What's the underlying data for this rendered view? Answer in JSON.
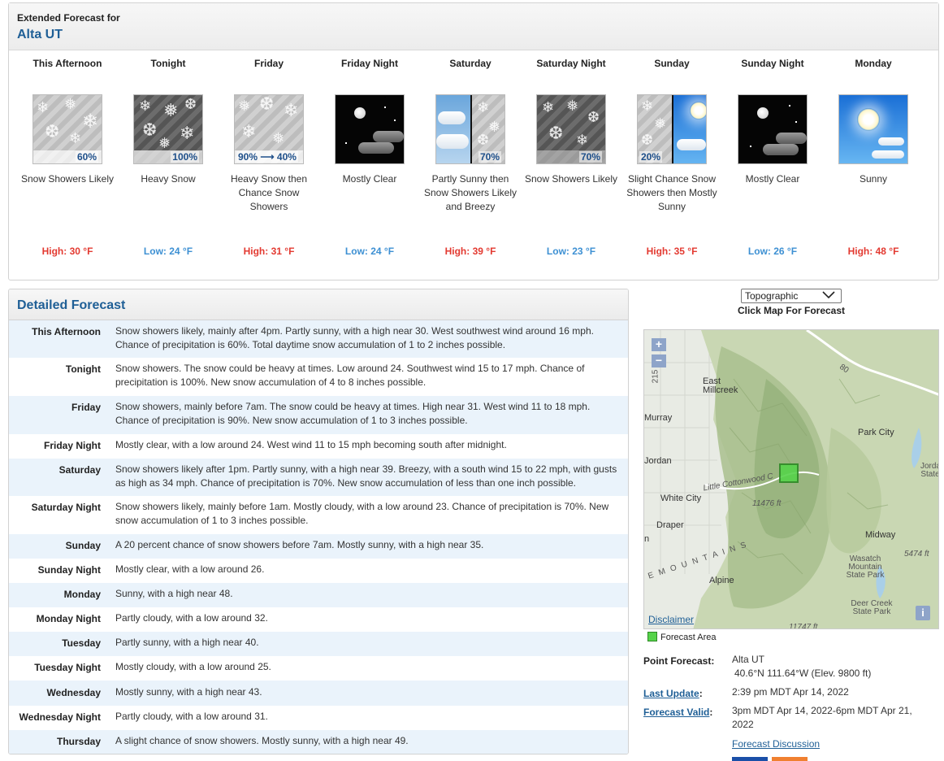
{
  "extended": {
    "heading_small": "Extended Forecast for",
    "location": "Alta UT",
    "periods": [
      {
        "name": "This Afternoon",
        "pct": "60%",
        "desc": "Snow Showers Likely",
        "temp": "High: 30 °F",
        "icon": "snow-showers-icon"
      },
      {
        "name": "Tonight",
        "pct": "100%",
        "desc": "Heavy Snow",
        "temp": "Low: 24 °F",
        "icon": "heavy-snow-icon"
      },
      {
        "name": "Friday",
        "pct": "90% ⟶ 40%",
        "desc": "Heavy Snow then Chance Snow Showers",
        "temp": "High: 31 °F",
        "icon": "snow-showers-icon"
      },
      {
        "name": "Friday Night",
        "pct": "",
        "desc": "Mostly Clear",
        "temp": "Low: 24 °F",
        "icon": "clear-night-icon"
      },
      {
        "name": "Saturday",
        "pct": "70%",
        "desc": "Partly Sunny then Snow Showers Likely and Breezy",
        "temp": "High: 39 °F",
        "icon": "partly-sunny-snow-icon"
      },
      {
        "name": "Saturday Night",
        "pct": "70%",
        "desc": "Snow Showers Likely",
        "temp": "Low: 23 °F",
        "icon": "snow-night-icon"
      },
      {
        "name": "Sunday",
        "pct": "20%",
        "desc": "Slight Chance Snow Showers then Mostly Sunny",
        "temp": "High: 35 °F",
        "icon": "snow-then-sunny-icon"
      },
      {
        "name": "Sunday Night",
        "pct": "",
        "desc": "Mostly Clear",
        "temp": "Low: 26 °F",
        "icon": "clear-night-icon"
      },
      {
        "name": "Monday",
        "pct": "",
        "desc": "Sunny",
        "temp": "High: 48 °F",
        "icon": "sunny-icon"
      }
    ]
  },
  "detailed": {
    "title": "Detailed Forecast",
    "rows": [
      {
        "label": "This Afternoon",
        "text": "Snow showers likely, mainly after 4pm. Partly sunny, with a high near 30. West southwest wind around 16 mph. Chance of precipitation is 60%. Total daytime snow accumulation of 1 to 2 inches possible."
      },
      {
        "label": "Tonight",
        "text": "Snow showers. The snow could be heavy at times. Low around 24. Southwest wind 15 to 17 mph. Chance of precipitation is 100%. New snow accumulation of 4 to 8 inches possible."
      },
      {
        "label": "Friday",
        "text": "Snow showers, mainly before 7am. The snow could be heavy at times. High near 31. West wind 11 to 18 mph. Chance of precipitation is 90%. New snow accumulation of 1 to 3 inches possible."
      },
      {
        "label": "Friday Night",
        "text": "Mostly clear, with a low around 24. West wind 11 to 15 mph becoming south after midnight."
      },
      {
        "label": "Saturday",
        "text": "Snow showers likely after 1pm. Partly sunny, with a high near 39. Breezy, with a south wind 15 to 22 mph, with gusts as high as 34 mph. Chance of precipitation is 70%. New snow accumulation of less than one inch possible."
      },
      {
        "label": "Saturday Night",
        "text": "Snow showers likely, mainly before 1am. Mostly cloudy, with a low around 23. Chance of precipitation is 70%. New snow accumulation of 1 to 3 inches possible."
      },
      {
        "label": "Sunday",
        "text": "A 20 percent chance of snow showers before 7am. Mostly sunny, with a high near 35."
      },
      {
        "label": "Sunday Night",
        "text": "Mostly clear, with a low around 26."
      },
      {
        "label": "Monday",
        "text": "Sunny, with a high near 48."
      },
      {
        "label": "Monday Night",
        "text": "Partly cloudy, with a low around 32."
      },
      {
        "label": "Tuesday",
        "text": "Partly sunny, with a high near 40."
      },
      {
        "label": "Tuesday Night",
        "text": "Mostly cloudy, with a low around 25."
      },
      {
        "label": "Wednesday",
        "text": "Mostly sunny, with a high near 43."
      },
      {
        "label": "Wednesday Night",
        "text": "Partly cloudy, with a low around 31."
      },
      {
        "label": "Thursday",
        "text": "A slight chance of snow showers. Mostly sunny, with a high near 49."
      }
    ]
  },
  "map": {
    "select_value": "Topographic",
    "click_label": "Click Map For Forecast",
    "zoom_in": "+",
    "zoom_out": "−",
    "info": "i",
    "disclaimer": "Disclaimer",
    "legend": "Forecast Area",
    "labels": {
      "east_millcreek": "East Millcreek",
      "murray": "Murray",
      "park_city": "Park City",
      "jordan": "Jordan",
      "jordanelle": "Jorda State",
      "white_city": "White City",
      "little_cottonwood": "Little Cottonwood C",
      "elev1": "11476 ft",
      "draper": "Draper",
      "n": "n",
      "midway": "Midway",
      "mountains": "E  M O U N T A I N S",
      "wasatch": "Wasatch Mountain State Park",
      "elev2": "5474 ft",
      "alpine": "Alpine",
      "deer_creek": "Deer Creek State Park",
      "elev3": "11747 ft",
      "road_80": "80",
      "road_215": "215"
    }
  },
  "point_info": {
    "point_label": "Point Forecast:",
    "point_value": "Alta UT",
    "coords": "40.6°N 111.64°W (Elev. 9800 ft)",
    "update_label": "Last Update",
    "update_colon": ":",
    "update_value": "2:39 pm MDT Apr 14, 2022",
    "valid_label": "Forecast Valid",
    "valid_colon": ":",
    "valid_value": "3pm MDT Apr 14, 2022-6pm MDT Apr 21, 2022",
    "discussion": "Forecast Discussion"
  },
  "colors": {
    "high": "#e33a31",
    "low": "#3d90d3",
    "link": "#1f5f96",
    "forecast_area": "#56d34a"
  }
}
